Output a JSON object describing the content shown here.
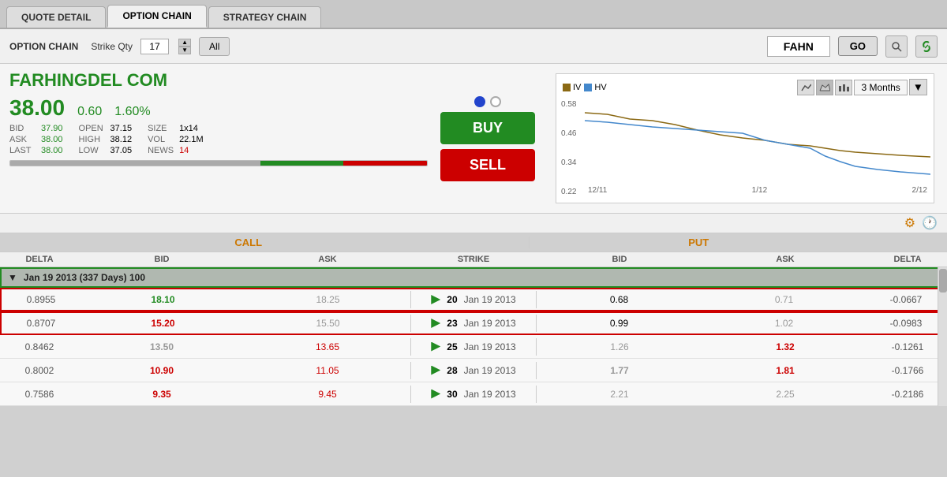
{
  "tabs": [
    {
      "id": "quote-detail",
      "label": "QUOTE DETAIL"
    },
    {
      "id": "option-chain",
      "label": "OPTION CHAIN"
    },
    {
      "id": "strategy-chain",
      "label": "STRATEGY CHAIN"
    }
  ],
  "activeTab": "option-chain",
  "header": {
    "optionChainLabel": "OPTION CHAIN",
    "strikeQtyLabel": "Strike Qty",
    "strikeQtyValue": "17",
    "allLabel": "All",
    "tickerValue": "FAHN",
    "goLabel": "GO"
  },
  "quote": {
    "companyName": "FARHINGDEL COM",
    "price": "38.00",
    "change": "0.60",
    "changePct": "1.60%",
    "bid": {
      "label": "BID",
      "value": "37.90"
    },
    "ask": {
      "label": "ASK",
      "value": "38.00"
    },
    "last": {
      "label": "LAST",
      "value": "38.00"
    },
    "open": {
      "label": "OPEN",
      "value": "37.15"
    },
    "high": {
      "label": "HIGH",
      "value": "38.12"
    },
    "low": {
      "label": "LOW",
      "value": "37.05"
    },
    "size": {
      "label": "SIZE",
      "value": "1x14"
    },
    "vol": {
      "label": "VOL",
      "value": "22.1M"
    },
    "news": {
      "label": "NEWS",
      "value": "14"
    },
    "buyLabel": "BUY",
    "sellLabel": "SELL"
  },
  "chart": {
    "legend": [
      {
        "id": "iv",
        "label": "IV",
        "color": "#8B6914"
      },
      {
        "id": "hv",
        "label": "HV",
        "color": "#4488cc"
      }
    ],
    "timeframe": "3 Months",
    "xLabels": [
      "12/11",
      "1/12",
      "2/12"
    ],
    "yLabels": [
      "0.58",
      "0.46",
      "0.34",
      "0.22"
    ]
  },
  "chain": {
    "callHeader": "CALL",
    "putHeader": "PUT",
    "columns": {
      "delta": "DELTA",
      "bid": "BID",
      "ask": "ASK",
      "strike": "STRIKE"
    },
    "expiryGroups": [
      {
        "label": "Jan 19 2013 (337 Days) 100",
        "rows": [
          {
            "id": "row-1",
            "highlighted": true,
            "callDelta": "0.8955",
            "callBid": "18.10",
            "callAsk": "18.25",
            "strike": "20",
            "strikeDate": "Jan 19 2013",
            "putBid": "0.68",
            "putAsk": "0.71",
            "putDelta": "-0.0667",
            "callBidColor": "green",
            "callAskColor": "gray"
          },
          {
            "id": "row-2",
            "highlighted": true,
            "callDelta": "0.8707",
            "callBid": "15.20",
            "callAsk": "15.50",
            "strike": "23",
            "strikeDate": "Jan 19 2013",
            "putBid": "0.99",
            "putAsk": "1.02",
            "putDelta": "-0.0983",
            "callBidColor": "red",
            "callAskColor": "gray"
          },
          {
            "id": "row-3",
            "highlighted": false,
            "callDelta": "0.8462",
            "callBid": "13.50",
            "callAsk": "13.65",
            "strike": "25",
            "strikeDate": "Jan 19 2013",
            "putBid": "1.26",
            "putAsk": "1.32",
            "putDelta": "-0.1261",
            "callBidColor": "gray",
            "callAskColor": "red"
          },
          {
            "id": "row-4",
            "highlighted": false,
            "callDelta": "0.8002",
            "callBid": "10.90",
            "callAsk": "11.05",
            "strike": "28",
            "strikeDate": "Jan 19 2013",
            "putBid": "1.77",
            "putAsk": "1.81",
            "putDelta": "-0.1766",
            "callBidColor": "red",
            "callAskColor": "red"
          },
          {
            "id": "row-5",
            "highlighted": false,
            "callDelta": "0.7586",
            "callBid": "9.35",
            "callAsk": "9.45",
            "strike": "30",
            "strikeDate": "Jan 19 2013",
            "putBid": "2.21",
            "putAsk": "2.25",
            "putDelta": "-0.2186",
            "callBidColor": "red",
            "callAskColor": "red"
          }
        ]
      }
    ]
  }
}
